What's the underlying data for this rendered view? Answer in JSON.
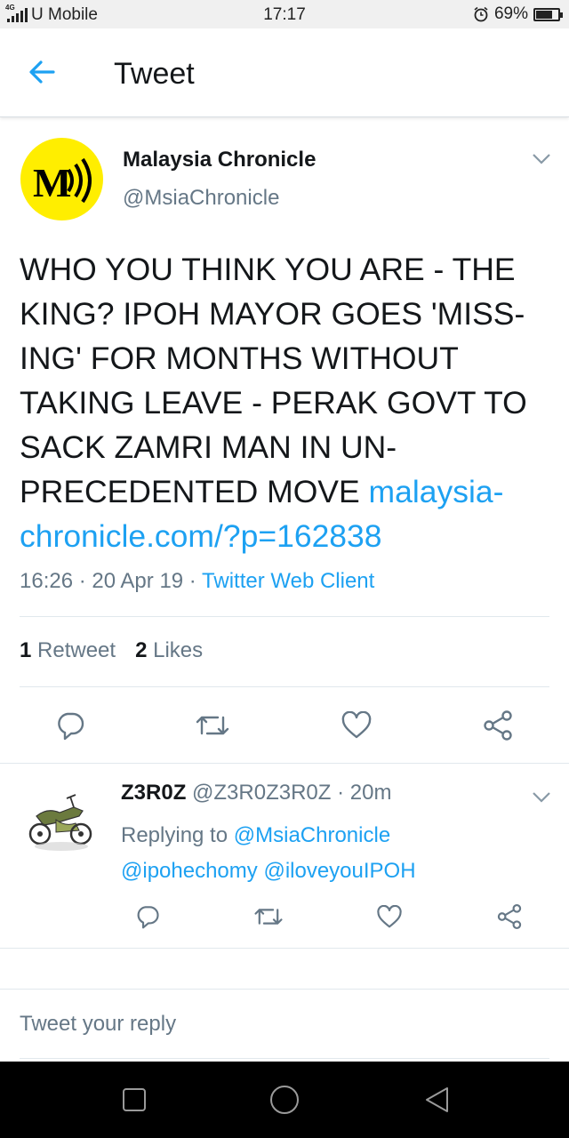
{
  "status_bar": {
    "network": "4G",
    "carrier": "U Mobile",
    "time": "17:17",
    "battery": "69%",
    "battery_level": 0.69
  },
  "header": {
    "title": "Tweet"
  },
  "tweet": {
    "author_name": "Malaysia Chronicle",
    "author_handle": "@MsiaChronicle",
    "text_main": "WHO YOU THINK YOU ARE - THE KING? IPOH MAYOR GOES 'MISS-ING' FOR MONTHS WITHOUT TAKING LEAVE - PERAK GOVT TO SACK ZAMRI MAN IN UN-PRECEDENTED MOVE ",
    "text_link": "malaysia-chronicle.com/?p=162838",
    "timestamp": "16:26 · 20 Apr 19 · ",
    "client": "Twitter Web Client",
    "retweets_count": "1",
    "retweets_label": "Retweet",
    "likes_count": "2",
    "likes_label": "Likes"
  },
  "reply": {
    "name": "Z3R0Z",
    "handle_time": "@Z3R0Z3R0Z · 20m",
    "replying_to_label": "Replying to ",
    "mention_1": "@MsiaChronicle",
    "mention_2": "@ipohechomy",
    "mention_3": "@iloveyouIPOH"
  },
  "compose": {
    "placeholder": "Tweet your reply"
  },
  "icons": {
    "accent": "#1da1f2",
    "secondary": "#657786"
  }
}
